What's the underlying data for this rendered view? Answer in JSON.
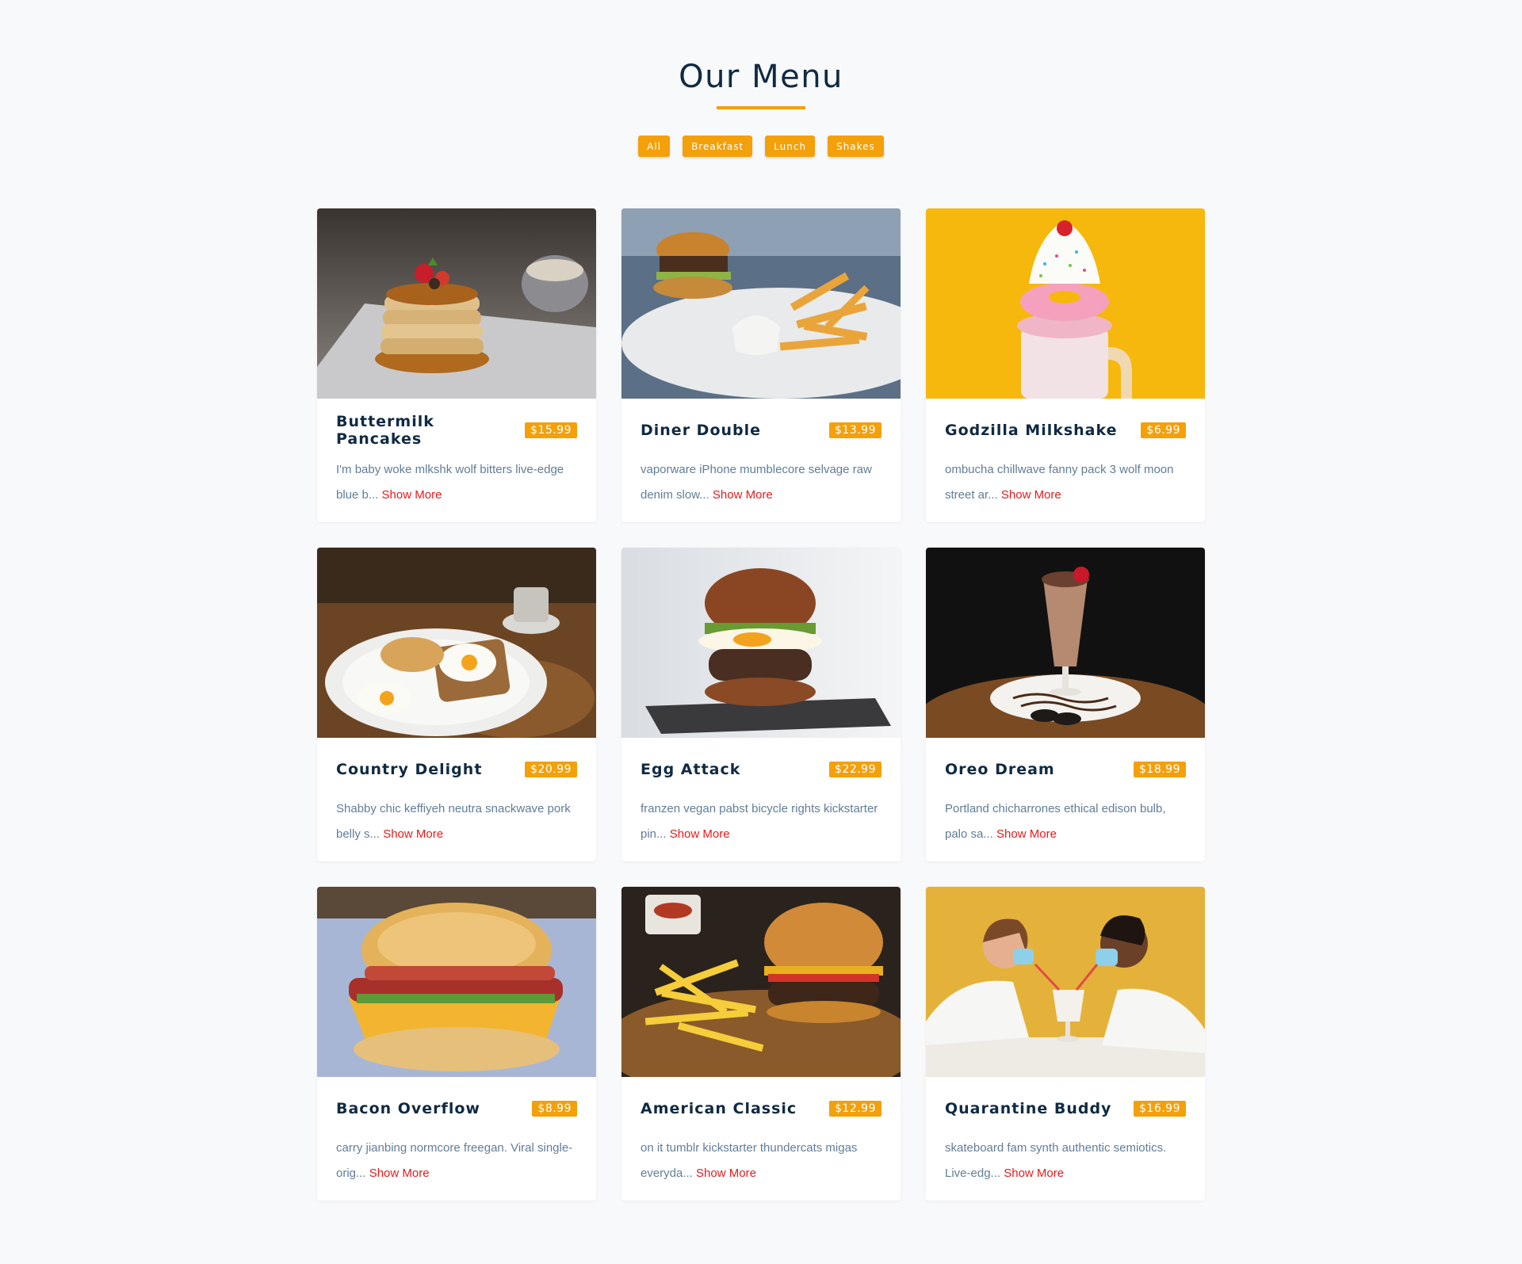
{
  "page": {
    "title": "Our Menu",
    "accent_color": "#f3a00b"
  },
  "filters": [
    {
      "label": "All"
    },
    {
      "label": "Breakfast"
    },
    {
      "label": "Lunch"
    },
    {
      "label": "Shakes"
    }
  ],
  "show_more_label": "Show More",
  "items": [
    {
      "name": "Buttermilk Pancakes",
      "price": "$15.99",
      "desc": "I'm baby woke mlkshk wolf bitters live-edge blue b...",
      "photo": "pancakes"
    },
    {
      "name": "Diner Double",
      "price": "$13.99",
      "desc": "vaporware iPhone mumblecore selvage raw denim slow...",
      "photo": "burger-fries"
    },
    {
      "name": "Godzilla Milkshake",
      "price": "$6.99",
      "desc": "ombucha chillwave fanny pack 3 wolf moon street ar...",
      "photo": "milkshake-yellow"
    },
    {
      "name": "Country Delight",
      "price": "$20.99",
      "desc": "Shabby chic keffiyeh neutra snackwave pork belly s...",
      "photo": "eggs-plate"
    },
    {
      "name": "Egg Attack",
      "price": "$22.99",
      "desc": "franzen vegan pabst bicycle rights kickstarter pin...",
      "photo": "egg-burger"
    },
    {
      "name": "Oreo Dream",
      "price": "$18.99",
      "desc": "Portland chicharrones ethical edison bulb, palo sa...",
      "photo": "oreo-shake"
    },
    {
      "name": "Bacon Overflow",
      "price": "$8.99",
      "desc": "carry jianbing normcore freegan. Viral single-orig...",
      "photo": "bacon-biscuit"
    },
    {
      "name": "American Classic",
      "price": "$12.99",
      "desc": "on it tumblr kickstarter thundercats migas everyda...",
      "photo": "classic-burger"
    },
    {
      "name": "Quarantine Buddy",
      "price": "$16.99",
      "desc": "skateboard fam synth authentic semiotics. Live-edg...",
      "photo": "couple-shake"
    }
  ]
}
